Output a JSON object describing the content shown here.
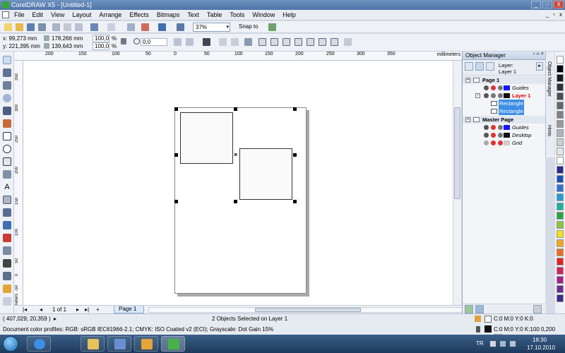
{
  "window": {
    "title": "CorelDRAW X5 - [Untitled-1]",
    "min": "_",
    "max": "□",
    "close": "X"
  },
  "menu": [
    "File",
    "Edit",
    "View",
    "Layout",
    "Arrange",
    "Effects",
    "Bitmaps",
    "Text",
    "Table",
    "Tools",
    "Window",
    "Help"
  ],
  "mdi": {
    "min": "_",
    "restore": "▫",
    "close": "x"
  },
  "toolbar": {
    "zoom": "37%",
    "snap": "Snap to"
  },
  "property_bar": {
    "x": "x:  99,273 mm",
    "y": "y:  221,395 mm",
    "w": "178,266 mm",
    "h": "139,643 mm",
    "scale_w": "100,0",
    "scale_h": "100,0",
    "pct": "%",
    "angle": "0,0"
  },
  "ruler_top": {
    "ticks": [
      "200",
      "150",
      "100",
      "50",
      "0",
      "50",
      "100",
      "150",
      "200",
      "250",
      "300",
      "350"
    ],
    "unit": "millimeters"
  },
  "ruler_left": {
    "ticks": [
      "350",
      "300",
      "250",
      "200",
      "150",
      "100",
      "50",
      "0",
      "-50"
    ],
    "unit": "millimeters"
  },
  "page_nav": {
    "counter": "1 of 1",
    "tab": "Page 1"
  },
  "object_manager": {
    "title": "Object Manager",
    "layer_label": "Layer:",
    "layer_name": "Layer 1",
    "page1": "Page 1",
    "guides": "Guides",
    "layer1": "Layer 1",
    "rect1": "Rectangle",
    "rect2": "Rectangle",
    "master": "Master Page",
    "mguides": "Guides",
    "desktop": "Desktop",
    "grid": "Grid"
  },
  "side_tabs": [
    "Object Manager",
    "Hints"
  ],
  "palette_colors": [
    "#ffffff",
    "#000000",
    "#1a1a1a",
    "#333333",
    "#4d4d4d",
    "#666666",
    "#808080",
    "#999999",
    "#b3b3b3",
    "#cccccc",
    "#e6e6e6",
    "#ffffff",
    "#2a2a8f",
    "#1c4fb5",
    "#3370d6",
    "#1f9fd6",
    "#1ab3a0",
    "#26a641",
    "#8cc63f",
    "#f2e11c",
    "#f7a51e",
    "#ee6b1f",
    "#e3221f",
    "#d6215b",
    "#a0238f",
    "#6a2c91",
    "#3d2a8c"
  ],
  "status": {
    "coords": "( 407,029; 20,359 )",
    "selection": "2 Objects Selected on Layer 1",
    "profiles": "Document color profiles: RGB: sRGB IEC61966-2.1; CMYK: ISO Coated v2 (ECI); Grayscale: Dot Gain 15%",
    "fill": "C:0 M:0 Y:0 K:0",
    "outline": "C:0 M:0 Y:0 K:100  0,200 mm"
  },
  "tray": {
    "lang": "TR",
    "time": "18:30",
    "date": "17.10.2010"
  }
}
